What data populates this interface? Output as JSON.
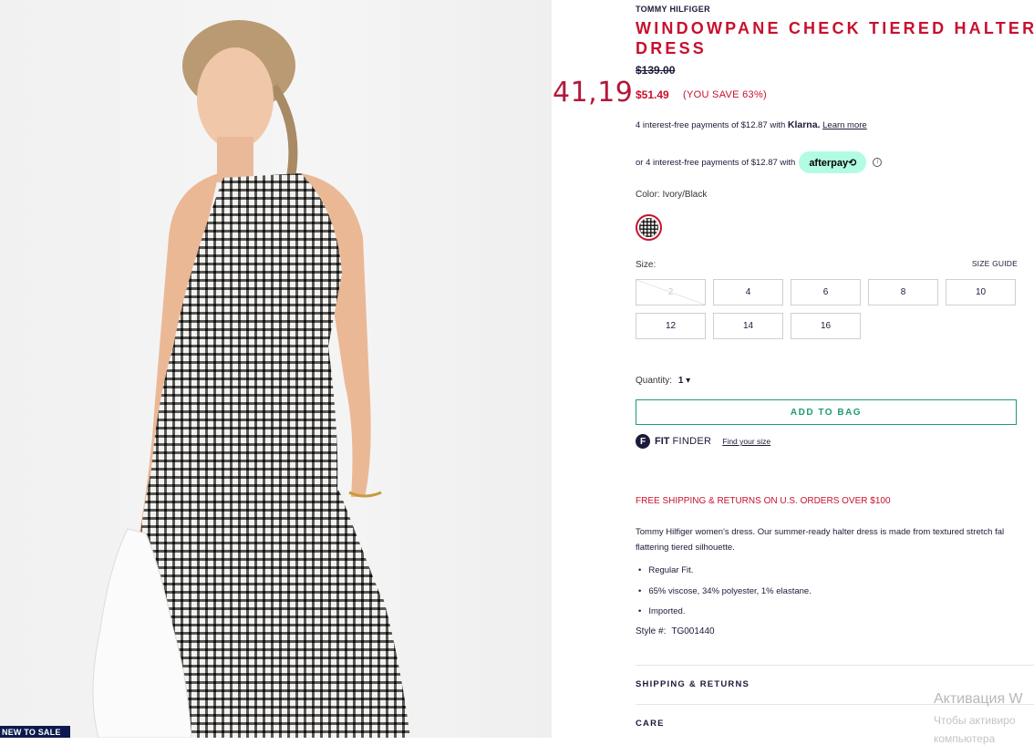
{
  "photo": {
    "alt": "",
    "badge": "NEW TO SALE"
  },
  "overlay_price": "41,19",
  "product": {
    "brand": "TOMMY HILFIGER",
    "title": "WINDOWPANE CHECK TIERED HALTER DRESS",
    "original_price": "$139.00",
    "sale_price": "$51.49",
    "you_save": "(YOU SAVE 63%)"
  },
  "klarna": {
    "text": "4 interest-free payments of $12.87 with",
    "brand": "Klarna.",
    "link": "Learn more"
  },
  "afterpay": {
    "text": "or 4 interest-free payments of $12.87 with",
    "badge": "afterpay⟲"
  },
  "color": {
    "label": "Color: Ivory/Black"
  },
  "size": {
    "label": "Size:",
    "guide": "SIZE GUIDE",
    "options": [
      {
        "label": "2",
        "available": false
      },
      {
        "label": "4",
        "available": true
      },
      {
        "label": "6",
        "available": true
      },
      {
        "label": "8",
        "available": true
      },
      {
        "label": "10",
        "available": true
      },
      {
        "label": "12",
        "available": true
      },
      {
        "label": "14",
        "available": true
      },
      {
        "label": "16",
        "available": true
      }
    ]
  },
  "quantity": {
    "label": "Quantity:",
    "value": "1 ▾"
  },
  "add_to_bag": "ADD TO BAG",
  "fit_finder": {
    "icon_letter": "F",
    "fit": "FIT",
    "finder": "FINDER",
    "link": "Find your size"
  },
  "shipping_promo": "FREE SHIPPING & RETURNS ON U.S. ORDERS OVER $100",
  "description": {
    "line1": "Tommy Hilfiger women's dress. Our summer-ready halter dress is made from textured stretch fal",
    "line2": "flattering tiered silhouette."
  },
  "details": [
    "Regular Fit.",
    "65% viscose, 34% polyester, 1% elastane.",
    "Imported."
  ],
  "style": {
    "label": "Style #:",
    "value": "TG001440"
  },
  "accordions": {
    "shipping": "SHIPPING & RETURNS",
    "care": "CARE"
  },
  "windows_activation": {
    "line1": "Активация W",
    "line2": "Чтобы активиро",
    "line3": "компьютера"
  },
  "colors": {
    "accent_red": "#c8102e",
    "navy": "#1b1b3a",
    "green": "#1e9a73",
    "afterpay_mint": "#b2fce4"
  }
}
